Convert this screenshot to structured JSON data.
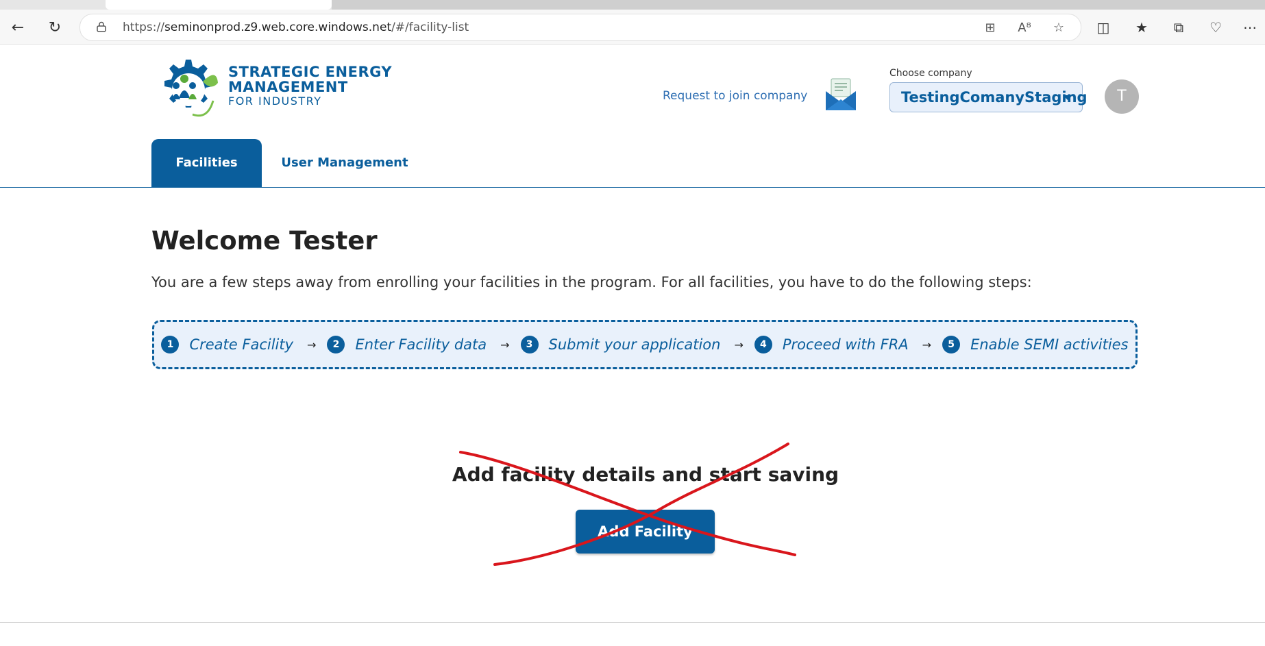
{
  "browser": {
    "url_prefix": "https://",
    "url_host": "seminonprod.z9.web.core.windows.net",
    "url_path": "/#/facility-list"
  },
  "header": {
    "logo_line1": "STRATEGIC ENERGY",
    "logo_line2": "MANAGEMENT",
    "logo_line3": "FOR INDUSTRY",
    "join_link": "Request to join company",
    "choose_company_label": "Choose company",
    "company_value": "TestingComanyStaging",
    "avatar_initial": "T"
  },
  "tabs": {
    "facilities": "Facilities",
    "user_management": "User Management"
  },
  "main": {
    "welcome": "Welcome Tester",
    "intro": "You are a few steps away from enrolling your facilities in the program. For all facilities, you have to do the following steps:",
    "steps": [
      {
        "num": "1",
        "label": "Create Facility"
      },
      {
        "num": "2",
        "label": "Enter Facility data"
      },
      {
        "num": "3",
        "label": "Submit your application"
      },
      {
        "num": "4",
        "label": "Proceed with FRA"
      },
      {
        "num": "5",
        "label": "Enable SEMI activities"
      }
    ],
    "cta_title": "Add facility details and start saving",
    "add_button": "Add Facility"
  },
  "colors": {
    "brand_blue": "#0a5e9c",
    "steps_bg": "#e9f1fb",
    "annotation_red": "#d9161c"
  }
}
